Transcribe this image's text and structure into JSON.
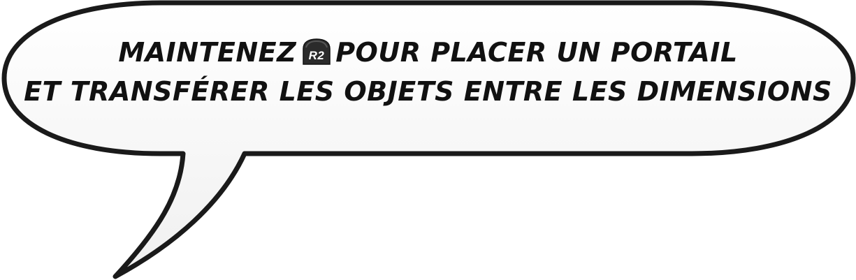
{
  "prompt": {
    "line1_before": "MAINTENEZ",
    "button_icon": "r2-shoulder-button-icon",
    "button_label": "R2",
    "line1_after": "POUR PLACER UN PORTAIL",
    "line2": "ET TRANSFÉRER LES OBJETS ENTRE LES DIMENSIONS"
  },
  "colors": {
    "bubble_fill": "#f8f8f8",
    "bubble_stroke": "#1a1a1a",
    "text": "#111111",
    "button_fill": "#2b2b2b",
    "button_text": "#ffffff"
  }
}
